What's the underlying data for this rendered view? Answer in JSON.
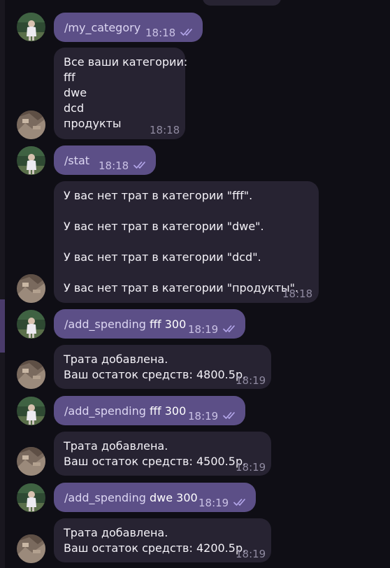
{
  "messages": [
    {
      "kind": "out",
      "command": "/my_category",
      "arg": "",
      "time": "18:18"
    },
    {
      "kind": "in",
      "text": "Все ваши категории:\nfff\ndwe\ndcd\nпродукты",
      "time": "18:18"
    },
    {
      "kind": "out",
      "command": "/stat",
      "arg": "",
      "time": "18:18"
    },
    {
      "kind": "in",
      "text": "У вас нет трат в категории \"fff\".\n\nУ вас нет трат в категории \"dwe\".\n\nУ вас нет трат в категории \"dcd\".\n\nУ вас нет трат в категории \"продукты\".",
      "time": "18:18"
    },
    {
      "kind": "out",
      "command": "/add_spending",
      "arg": "fff 300",
      "time": "18:19"
    },
    {
      "kind": "in",
      "text": "Трата добавлена.\nВаш остаток средств: 4800.5р.",
      "time": "18:19"
    },
    {
      "kind": "out",
      "command": "/add_spending",
      "arg": "fff 300",
      "time": "18:19"
    },
    {
      "kind": "in",
      "text": "Трата добавлена.\nВаш остаток средств: 4500.5р.",
      "time": "18:19"
    },
    {
      "kind": "out",
      "command": "/add_spending",
      "arg": "dwe 300",
      "time": "18:19"
    },
    {
      "kind": "in",
      "text": "Трата добавлена.\nВаш остаток средств: 4200.5р.",
      "time": "18:19"
    }
  ],
  "colors": {
    "outgoing_bubble": "#5c4f87",
    "incoming_bubble": "#272332",
    "background": "#0f0e15",
    "read_check": "#b3a6ea"
  },
  "icons": {
    "read_receipt": "double-check-icon"
  }
}
